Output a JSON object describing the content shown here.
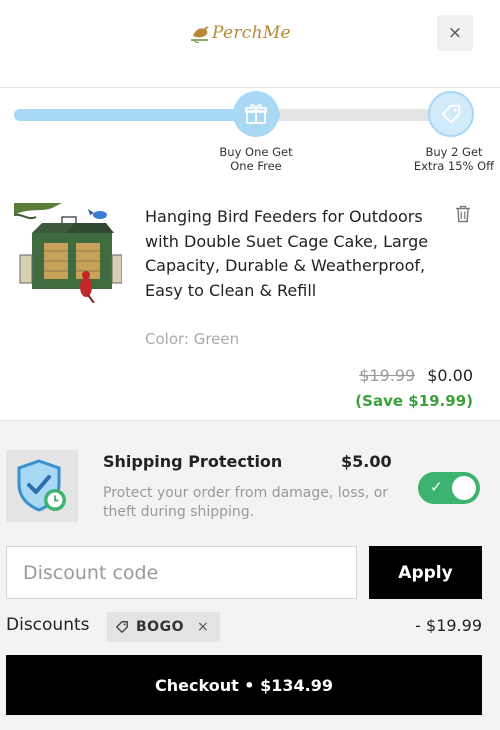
{
  "header": {
    "logo_text": "PerchMe",
    "close_label": "×"
  },
  "progress": {
    "fraction": 0.61,
    "milestones": [
      {
        "label_line1": "Buy One Get",
        "label_line2": "One Free",
        "icon": "gift-icon"
      },
      {
        "label_line1": "Buy 2 Get",
        "label_line2": "Extra 15% Off",
        "icon": "tag-icon"
      }
    ]
  },
  "product": {
    "title": "Hanging Bird Feeders for Outdoors with Double Suet Cage Cake, Large Capacity, Durable & Weatherproof, Easy to Clean & Refill",
    "variant": "Color: Green",
    "price_original": "$19.99",
    "price_current": "$0.00",
    "savings": "(Save $19.99)",
    "icon": "trash-icon"
  },
  "shipping_protection": {
    "title": "Shipping Protection",
    "price": "$5.00",
    "description": "Protect your order from damage, loss, or theft during shipping.",
    "enabled": true,
    "toggle_check": "✓",
    "icon": "shield-icon"
  },
  "discount": {
    "placeholder": "Discount code",
    "apply_label": "Apply",
    "label": "Discounts",
    "code": "BOGO",
    "remove_label": "×",
    "amount": "- $19.99"
  },
  "checkout": {
    "label": "Checkout • $134.99"
  },
  "colors": {
    "progress_fill": "#a9d8f5",
    "accent_green": "#3cb371",
    "save_green": "#3aa13a",
    "logo_gold": "#b8893a"
  }
}
